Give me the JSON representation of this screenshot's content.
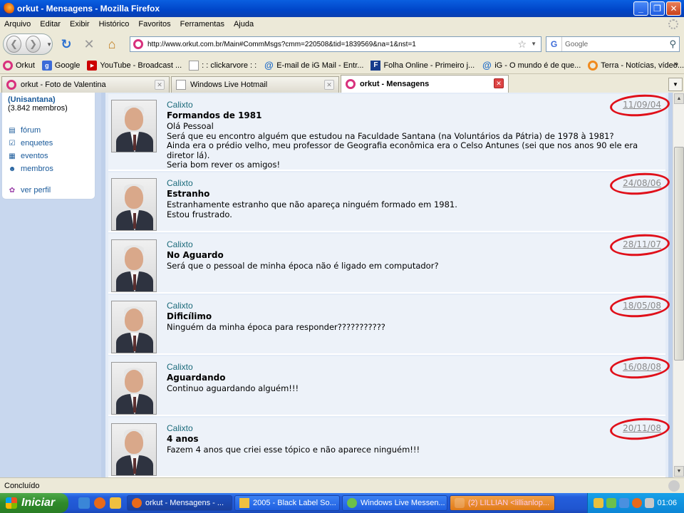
{
  "window": {
    "title": "orkut - Mensagens - Mozilla Firefox"
  },
  "menu": [
    "Arquivo",
    "Editar",
    "Exibir",
    "Histórico",
    "Favoritos",
    "Ferramentas",
    "Ajuda"
  ],
  "address": {
    "url": "http://www.orkut.com.br/Main#CommMsgs?cmm=220508&tid=1839569&na=1&nst=1"
  },
  "search": {
    "placeholder": "Google",
    "engine": "G"
  },
  "bookmarks": [
    {
      "label": "Orkut",
      "icon": "orkut-icon"
    },
    {
      "label": "Google",
      "icon": "google-icon"
    },
    {
      "label": "YouTube - Broadcast ...",
      "icon": "youtube-icon"
    },
    {
      "label": ": : clickarvore : :",
      "icon": "page-icon"
    },
    {
      "label": "E-mail de iG Mail - Entr...",
      "icon": "ig-icon"
    },
    {
      "label": "Folha Online - Primeiro j...",
      "icon": "folha-icon"
    },
    {
      "label": "iG - O mundo é de que...",
      "icon": "ig-icon"
    },
    {
      "label": "Terra - Notícias, vídeo...",
      "icon": "terra-icon"
    }
  ],
  "bookmarks_more": "»",
  "tabs": [
    {
      "label": "orkut - Foto de Valentina",
      "active": false
    },
    {
      "label": "Windows Live Hotmail",
      "active": false
    },
    {
      "label": "orkut - Mensagens",
      "active": true
    }
  ],
  "sidebar": {
    "community": "(Unisantana)",
    "members": "(3.842 membros)",
    "items": [
      {
        "label": "fórum",
        "icon": "forum-icon"
      },
      {
        "label": "enquetes",
        "icon": "poll-icon"
      },
      {
        "label": "eventos",
        "icon": "calendar-icon"
      },
      {
        "label": "membros",
        "icon": "members-icon"
      }
    ],
    "profile": "ver perfil"
  },
  "messages": [
    {
      "author": "Calixto",
      "subject": "Formandos de 1981",
      "date": "11/09/04",
      "body": [
        "Olá Pessoal",
        "Será que eu encontro alguém que estudou na Faculdade Santana (na Voluntários da Pátria) de 1978 à 1981?",
        "Ainda era o prédio velho, meu professor de Geografia econômica era o Celso Antunes (sei que nos anos 90 ele era diretor lá).",
        "Seria bom rever os amigos!"
      ]
    },
    {
      "author": "Calixto",
      "subject": "Estranho",
      "date": "24/08/06",
      "body": [
        "Estranhamente estranho que não apareça ninguém formado em 1981.",
        "Estou frustrado."
      ]
    },
    {
      "author": "Calixto",
      "subject": "No Aguardo",
      "date": "28/11/07",
      "body": [
        "Será que o pessoal de minha época não é ligado em computador?"
      ]
    },
    {
      "author": "Calixto",
      "subject": "Dificílimo",
      "date": "18/05/08",
      "body": [
        "Ninguém da minha época para responder???????????"
      ]
    },
    {
      "author": "Calixto",
      "subject": "Aguardando",
      "date": "16/08/08",
      "body": [
        "Continuo aguardando alguém!!!"
      ]
    },
    {
      "author": "Calixto",
      "subject": "4 anos",
      "date": "20/11/08",
      "body": [
        "Fazem 4 anos que criei esse tópico e não aparece ninguém!!!"
      ]
    }
  ],
  "status": {
    "text": "Concluído"
  },
  "taskbar": {
    "start": "Iniciar",
    "items": [
      {
        "label": "orkut - Mensagens - ...",
        "state": "active"
      },
      {
        "label": "2005 - Black Label So...",
        "state": "normal"
      },
      {
        "label": "Windows Live Messen...",
        "state": "normal"
      },
      {
        "label": "(2) LILLIAN <lillianlop...",
        "state": "flash"
      }
    ],
    "clock": "01:06"
  },
  "colors": {
    "highlight_circle": "#e0101a",
    "link": "#1a6a7a",
    "taskbar": "#245edb"
  }
}
